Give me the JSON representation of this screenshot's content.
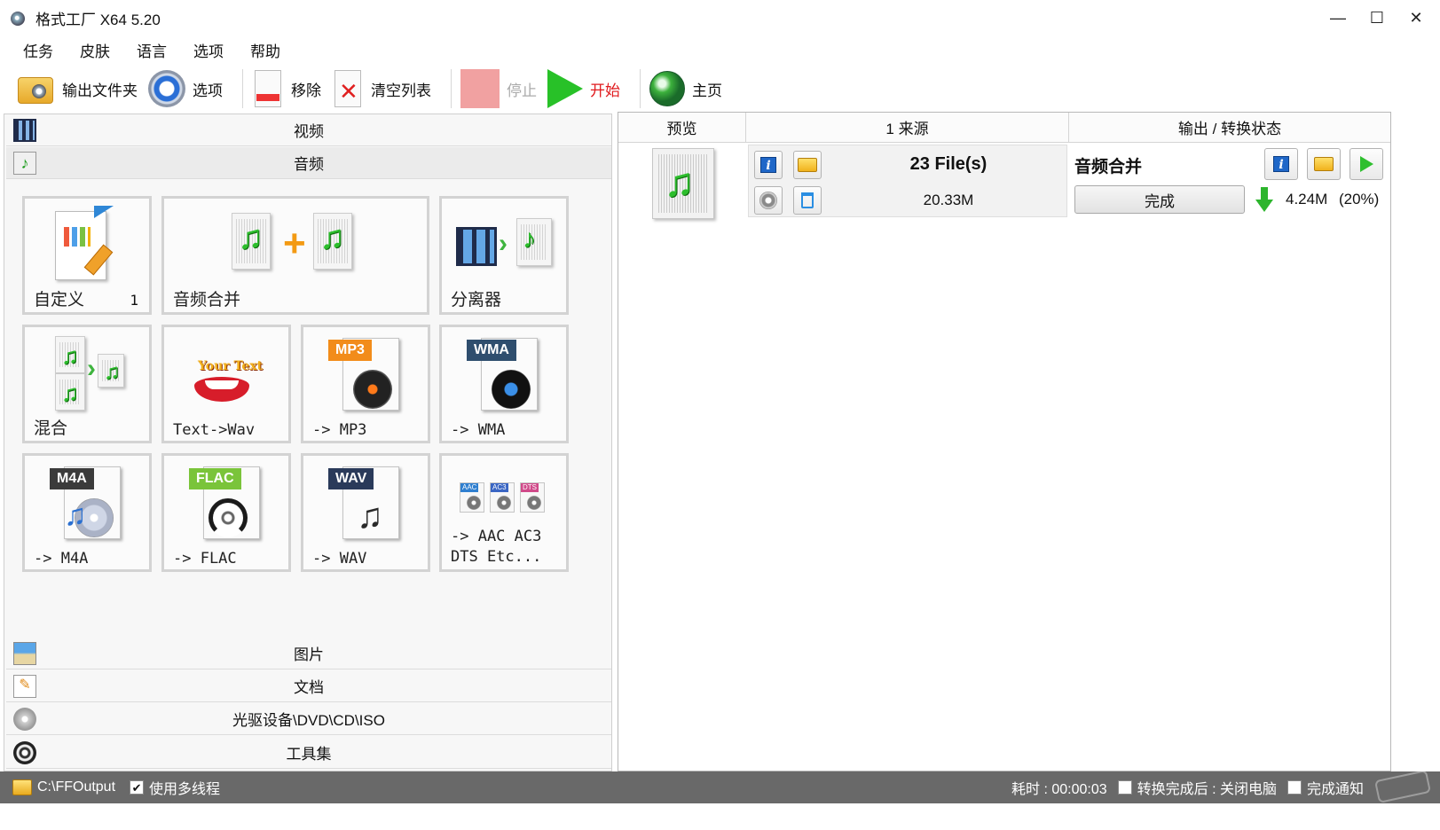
{
  "window": {
    "title": "格式工厂 X64 5.20",
    "controls": {
      "minimize": "—",
      "maximize": "☐",
      "close": "✕"
    }
  },
  "menu": [
    "任务",
    "皮肤",
    "语言",
    "选项",
    "帮助"
  ],
  "toolbar": {
    "output_folder": "输出文件夹",
    "options": "选项",
    "remove": "移除",
    "clear_list": "清空列表",
    "stop": "停止",
    "start": "开始",
    "home": "主页"
  },
  "categories": {
    "video": "视频",
    "audio": "音频",
    "picture": "图片",
    "document": "文档",
    "rom_device": "光驱设备\\DVD\\CD\\ISO",
    "tools": "工具集"
  },
  "audio_tiles": [
    {
      "label": "自定义",
      "count": "1"
    },
    {
      "label": "音频合并"
    },
    {
      "label": "分离器"
    },
    {
      "label": "混合"
    },
    {
      "label": "Text->Wav",
      "art_text": "Your Text"
    },
    {
      "label": "-> MP3",
      "tag": "MP3"
    },
    {
      "label": "-> WMA",
      "tag": "WMA"
    },
    {
      "label": "-> M4A",
      "tag": "M4A"
    },
    {
      "label": "-> FLAC",
      "tag": "FLAC"
    },
    {
      "label": "-> WAV",
      "tag": "WAV"
    },
    {
      "label": "-> AAC AC3\nDTS Etc...",
      "tags": [
        "AAC",
        "AC3",
        "DTS"
      ]
    }
  ],
  "task_list": {
    "headers": {
      "preview": "预览",
      "source": "1 来源",
      "output": "输出 / 转换状态"
    },
    "tasks": [
      {
        "file_count": "23 File(s)",
        "source_size": "20.33M",
        "output_name": "音频合并",
        "status": "完成",
        "output_size": "4.24M",
        "output_ratio": "(20%)"
      }
    ]
  },
  "statusbar": {
    "output_path": "C:\\FFOutput",
    "multithread_label": "使用多线程",
    "multithread_checked": true,
    "elapsed": "耗时 : 00:00:03",
    "after_convert_label": "转换完成后 : 关闭电脑",
    "after_convert_checked": false,
    "notify_label": "完成通知",
    "notify_checked": false
  },
  "colors": {
    "start_text": "#e0191c",
    "stop_disabled": "#f1a1a1",
    "statusbar_bg": "#696969",
    "tag_mp3": "#f28c1a",
    "tag_wma": "#2f4e6e",
    "tag_m4a": "#3b3b3b",
    "tag_flac": "#7ac43a",
    "tag_wav": "#2a3a5a"
  }
}
